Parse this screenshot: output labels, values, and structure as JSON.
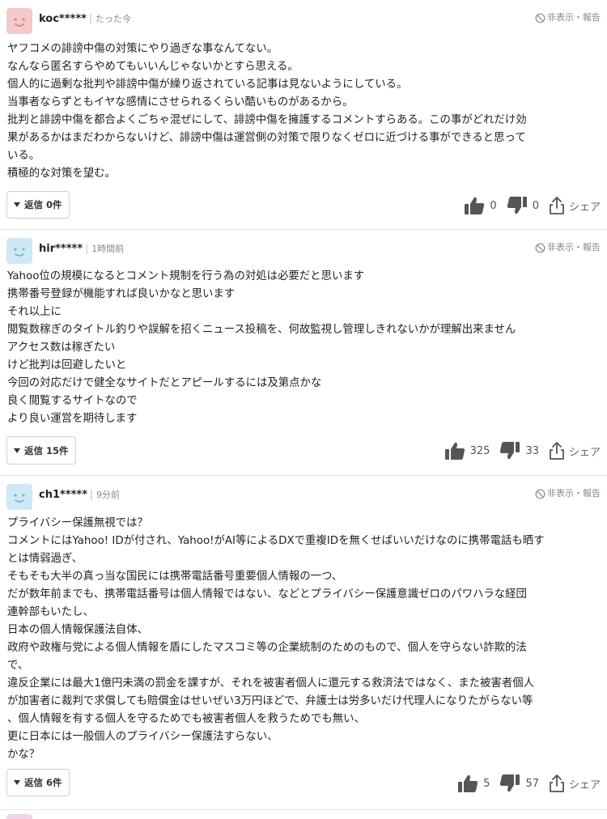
{
  "comments": [
    {
      "user": "koc*****",
      "time": "たった今",
      "avatar_color": "#f3c9c9",
      "avatar_face": "#e07e7e",
      "hide_report": "非表示・報告",
      "lines": [
        "ヤフコメの誹謗中傷の対策にやり過ぎな事なんてない。",
        "なんなら匿名すらやめてもいいんじゃないかとすら思える。",
        "個人的に過剰な批判や誹謗中傷が繰り返されている記事は見ないようにしている。",
        "当事者ならずともイヤな感情にさせられるくらい酷いものがあるから。",
        "批判と誹謗中傷を都合よくごちゃ混ぜにして、誹謗中傷を擁護するコメントすらある。この事がどれだけ効",
        "果があるかはまだわからないけど、誹謗中傷は運営側の対策で限りなくゼロに近づける事ができると思って",
        "いる。",
        "積極的な対策を望む。"
      ],
      "reply_label": "返信 0件",
      "likes": "0",
      "dislikes": "0",
      "share": "シェア"
    },
    {
      "user": "hir*****",
      "time": "1時間前",
      "avatar_color": "#cfe8f3",
      "avatar_face": "#6fb6d8",
      "hide_report": "非表示・報告",
      "lines": [
        "Yahoo位の規模になるとコメント規制を行う為の対処は必要だと思います",
        "携帯番号登録が機能すれば良いかなと思います",
        "それ以上に",
        "閲覧数稼ぎのタイトル釣りや誤解を招くニュース投稿を、何故監視し管理しきれないかが理解出来ません",
        "アクセス数は稼ぎたい",
        "けど批判は回避したいと",
        "今回の対応だけで健全なサイトだとアピールするには及第点かな",
        "良く閲覧するサイトなので",
        "より良い運営を期待します"
      ],
      "reply_label": "返信 15件",
      "likes": "325",
      "dislikes": "33",
      "share": "シェア"
    },
    {
      "user": "ch1*****",
      "time": "9分前",
      "avatar_color": "#cfe8f3",
      "avatar_face": "#6fb6d8",
      "hide_report": "非表示・報告",
      "lines": [
        "プライバシー保護無視では？",
        "コメントにはYahoo! IDが付され、Yahoo!がAI等によるDXで重複IDを無くせばいいだけなのに携帯電話も晒す",
        "とは情弱過ぎ、",
        "そもそも大半の真っ当な国民には携帯電話番号重要個人情報の一つ、",
        "だが数年前までも、携帯電話番号は個人情報ではない、などとプライバシー保護意識ゼロのパワハラな経団",
        "連幹部もいたし、",
        "日本の個人情報保護法自体、",
        "政府や政権与党による個人情報を盾にしたマスコミ等の企業統制のためのもので、個人を守らない詐欺的法",
        "で、",
        "違反企業には最大1億円未満の罰金を課すが、それを被害者個人に還元する救済法ではなく、また被害者個人",
        "が加害者に裁判で求償しても賠償金はせいぜい3万円ほどで、弁護士は労多いだけ代理人になりたがらない等",
        "、個人情報を有する個人を守るためでも被害者個人を救うためでも無い、",
        "更に日本には一般個人のプライバシー保護法すらない、",
        "かな？"
      ],
      "reply_label": "返信 6件",
      "likes": "5",
      "dislikes": "57",
      "share": "シェア"
    }
  ]
}
